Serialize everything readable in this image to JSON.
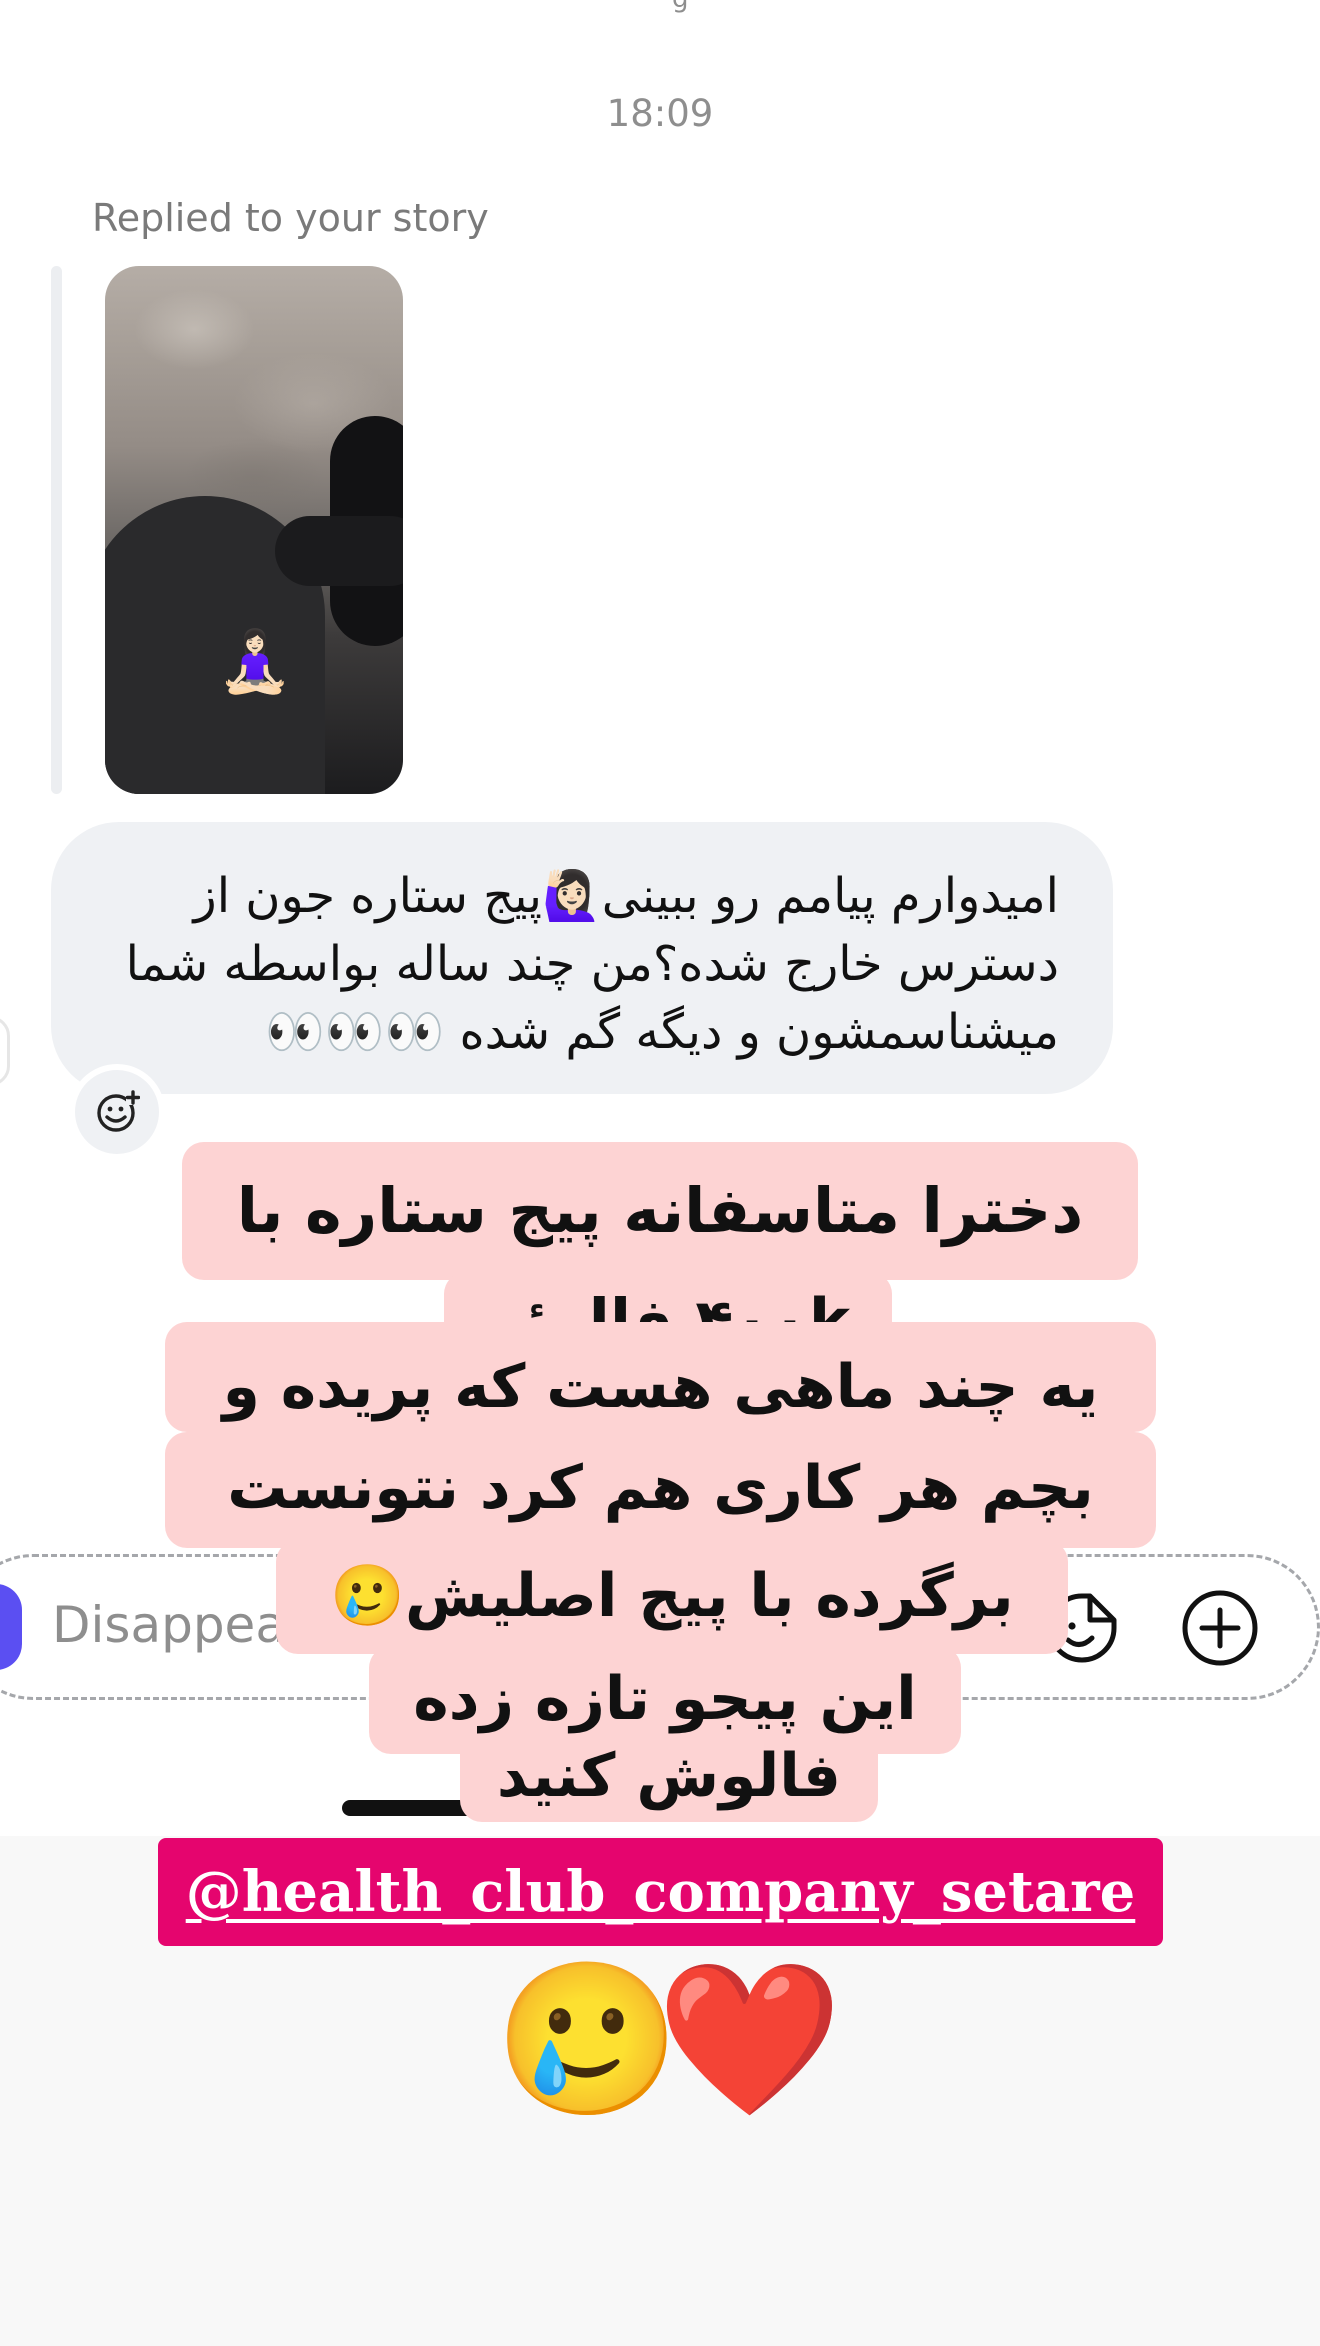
{
  "chat": {
    "timestamp": "18:09",
    "replied_label": "Replied to your story",
    "story_emoji": "🧘🏻‍♀️",
    "message_lines": [
      "امیدوارم پیامم رو ببینی🙋🏻‍♀️پیج ستاره جون از",
      "دسترس خارج شده؟من چند ساله بواسطه شما",
      "میشناسمشون و دیگه گم شده 👀👀👀"
    ]
  },
  "composer": {
    "placeholder": "Disappearing"
  },
  "story_caption": {
    "line1": "دخترا متاسفانه پیج ستاره با",
    "line2": "۴۰۰k فالوئر",
    "line3": "یه چند ماهی هست که پریده و",
    "line4": "بچم هر کاری هم کرد نتونست",
    "line5": "برگرده با پیج اصلیش🥲",
    "line6": "این پیجو تازه زده",
    "line7": "فالوش کنید",
    "mention": "@health_club_company_setare",
    "sticker_sad": "🥲",
    "sticker_heart": "❤️"
  },
  "colors": {
    "caption_bg": "#fdd3d3",
    "mention_bg": "#e5056e",
    "bubble_bg": "#eff1f4",
    "camera_blue": "#5b4ff2"
  }
}
